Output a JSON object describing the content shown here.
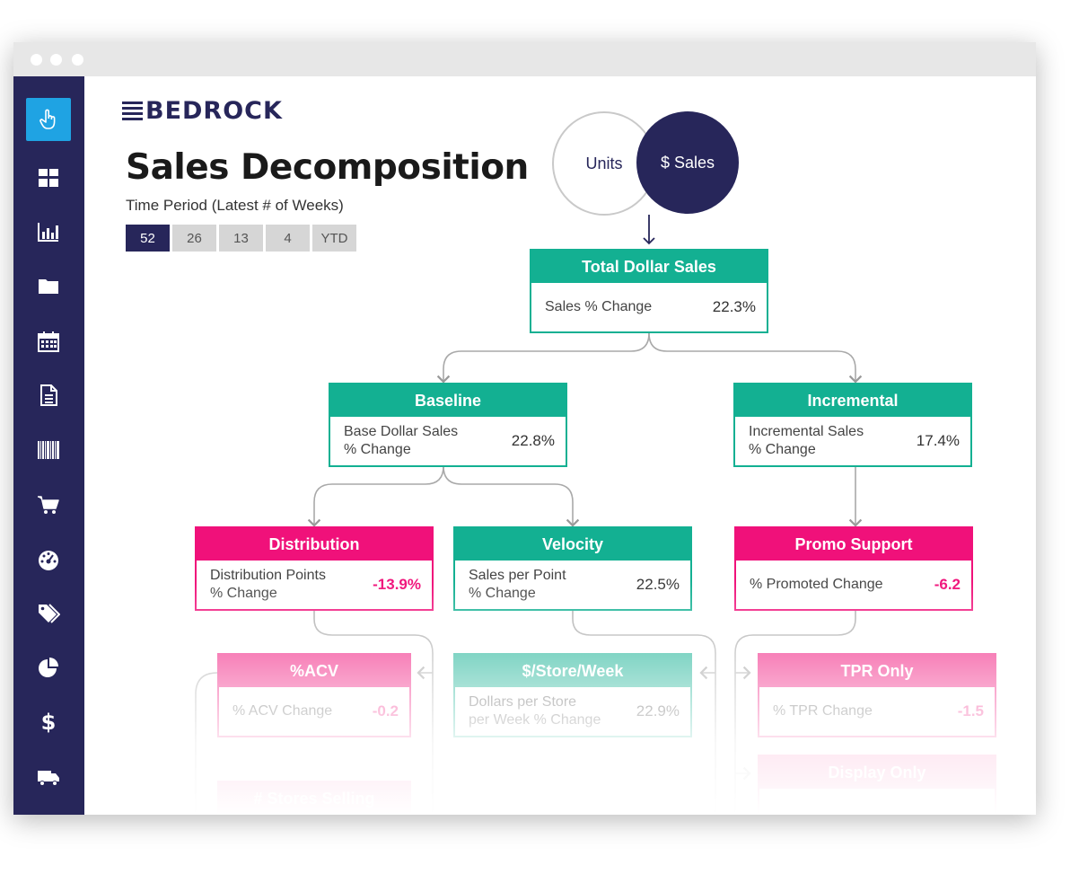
{
  "app": {
    "logo": "BEDROCK",
    "title": "Sales Decomposition"
  },
  "time_period": {
    "label": "Time Period (Latest # of Weeks)",
    "options": [
      "52",
      "26",
      "13",
      "4",
      "YTD"
    ],
    "selected": "52"
  },
  "toggle": {
    "left": "Units",
    "right": "$ Sales",
    "selected": "$ Sales"
  },
  "sidebar": {
    "items": [
      {
        "icon": "pointer-icon",
        "active": true
      },
      {
        "icon": "dashboard-icon"
      },
      {
        "icon": "bar-chart-icon"
      },
      {
        "icon": "folder-icon"
      },
      {
        "icon": "calendar-icon"
      },
      {
        "icon": "document-icon"
      },
      {
        "icon": "barcode-icon"
      },
      {
        "icon": "cart-icon"
      },
      {
        "icon": "gauge-icon"
      },
      {
        "icon": "tags-icon"
      },
      {
        "icon": "pie-chart-icon"
      },
      {
        "icon": "dollar-icon"
      },
      {
        "icon": "truck-icon"
      }
    ]
  },
  "tree": {
    "total": {
      "title": "Total Dollar Sales",
      "metric": "Sales % Change",
      "value": "22.3%"
    },
    "baseline": {
      "title": "Baseline",
      "metric_line1": "Base Dollar Sales",
      "metric_line2": "% Change",
      "value": "22.8%"
    },
    "incremental": {
      "title": "Incremental",
      "metric_line1": "Incremental Sales",
      "metric_line2": "% Change",
      "value": "17.4%"
    },
    "distribution": {
      "title": "Distribution",
      "metric_line1": "Distribution Points",
      "metric_line2": "% Change",
      "value": "-13.9%"
    },
    "velocity": {
      "title": "Velocity",
      "metric_line1": "Sales per Point",
      "metric_line2": "% Change",
      "value": "22.5%"
    },
    "promo": {
      "title": "Promo Support",
      "metric": "% Promoted Change",
      "value": "-6.2"
    },
    "acv": {
      "title": "%ACV",
      "metric": "% ACV Change",
      "value": "-0.2"
    },
    "store_week": {
      "title": "$/Store/Week",
      "metric_line1": "Dollars per Store",
      "metric_line2": "per Week % Change",
      "value": "22.9%"
    },
    "tpr": {
      "title": "TPR Only",
      "metric": "% TPR Change",
      "value": "-1.5"
    },
    "display": {
      "title": "Display Only"
    },
    "stores_selling": {
      "title": "# Stores Selling"
    }
  },
  "colors": {
    "navy": "#27265a",
    "teal": "#13b092",
    "pink": "#f0117a",
    "active_blue": "#1fa3e3"
  }
}
